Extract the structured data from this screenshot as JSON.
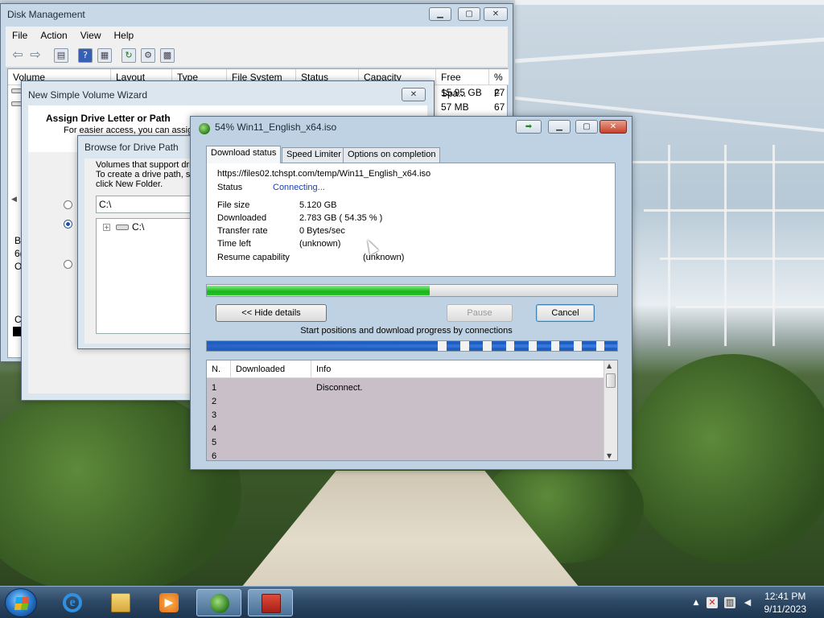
{
  "disk_management": {
    "title": "Disk Management",
    "menu": [
      "File",
      "Action",
      "View",
      "Help"
    ],
    "columns": [
      "Volume",
      "Layout",
      "Type",
      "File System",
      "Status",
      "Capacity",
      "Free Spa...",
      "% F"
    ],
    "rows": [
      {
        "free": "15.95 GB",
        "pct": "27"
      },
      {
        "free": "57 MB",
        "pct": "67"
      }
    ],
    "left_fragments": [
      "B",
      "6(",
      "O",
      "C"
    ]
  },
  "wizard": {
    "title": "New Simple Volume Wizard",
    "heading": "Assign Drive Letter or Path",
    "subheading": "For easier access, you can assign"
  },
  "browse": {
    "title": "Browse for Drive Path",
    "line1": "Volumes that support driv",
    "line2": "To create a drive path, se",
    "line3": "click New Folder.",
    "path_value": "C:\\",
    "tree_root": "C:\\"
  },
  "idm": {
    "title": "54% Win11_English_x64.iso",
    "tabs": [
      "Download status",
      "Speed Limiter",
      "Options on completion"
    ],
    "url": "https://files02.tchspt.com/temp/Win11_English_x64.iso",
    "status_label": "Status",
    "status_value": "Connecting...",
    "fields": [
      {
        "label": "File size",
        "value": "5.120  GB"
      },
      {
        "label": "Downloaded",
        "value": "2.783  GB  ( 54.35 % )"
      },
      {
        "label": "Transfer rate",
        "value": "0  Bytes/sec"
      },
      {
        "label": "Time left",
        "value": "(unknown)"
      },
      {
        "label": "Resume capability",
        "value": "(unknown)"
      }
    ],
    "progress_fraction": 0.5435,
    "buttons": {
      "hide_details": "<< Hide details",
      "pause": "Pause",
      "cancel": "Cancel"
    },
    "connections_caption": "Start positions and download progress by connections",
    "list_columns": [
      "N.",
      "Downloaded",
      "Info"
    ],
    "list_rows": [
      {
        "n": "1",
        "info": "Disconnect."
      },
      {
        "n": "2",
        "info": ""
      },
      {
        "n": "3",
        "info": ""
      },
      {
        "n": "4",
        "info": ""
      },
      {
        "n": "5",
        "info": ""
      },
      {
        "n": "6",
        "info": ""
      }
    ]
  },
  "taskbar": {
    "time": "12:41 PM",
    "date": "9/11/2023",
    "pinned": [
      "internet-explorer-icon",
      "file-explorer-icon",
      "media-player-icon",
      "idm-icon",
      "toolbox-icon"
    ]
  },
  "colors": {
    "progress": "#1bb51b",
    "accent_link": "#1a3fb0"
  }
}
